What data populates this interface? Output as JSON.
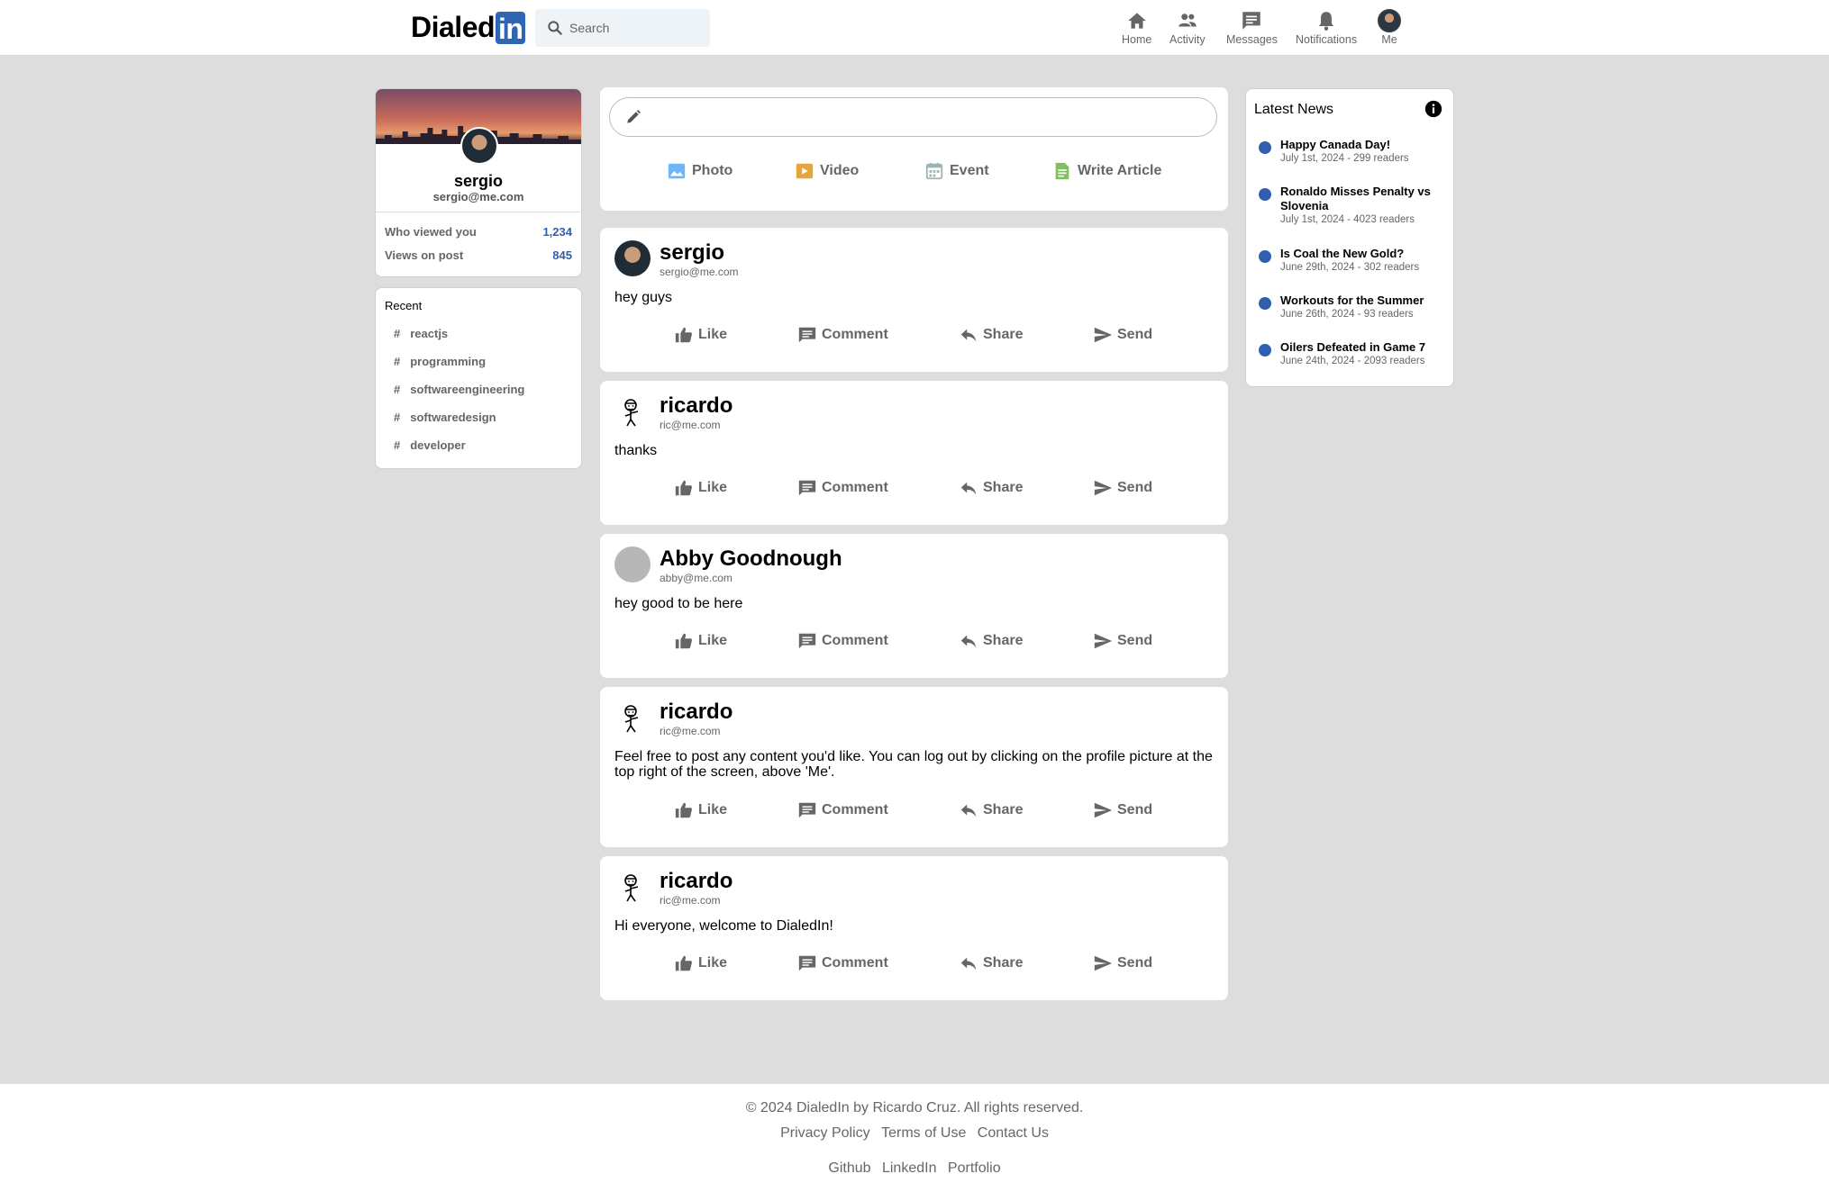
{
  "header": {
    "logo_text": "Dialed",
    "logo_badge": "in",
    "search_placeholder": "Search",
    "nav": [
      {
        "label": "Home",
        "icon": "home-icon"
      },
      {
        "label": "Activity",
        "icon": "people-icon"
      },
      {
        "label": "Messages",
        "icon": "message-icon"
      },
      {
        "label": "Notifications",
        "icon": "bell-icon"
      },
      {
        "label": "Me",
        "icon": "avatar"
      }
    ]
  },
  "profile": {
    "name": "sergio",
    "email": "sergio@me.com",
    "stats": [
      {
        "label": "Who viewed you",
        "value": "1,234"
      },
      {
        "label": "Views on post",
        "value": "845"
      }
    ]
  },
  "recent": {
    "title": "Recent",
    "tags": [
      "reactjs",
      "programming",
      "softwareengineering",
      "softwaredesign",
      "developer"
    ]
  },
  "composer": {
    "actions": [
      {
        "label": "Photo",
        "icon": "photo-icon",
        "color": "#70b5f9"
      },
      {
        "label": "Video",
        "icon": "video-icon",
        "color": "#e7a33e"
      },
      {
        "label": "Event",
        "icon": "calendar-icon",
        "color": "#a0b4b7"
      },
      {
        "label": "Write Article",
        "icon": "article-icon",
        "color": "#7fc15e"
      }
    ]
  },
  "post_actions": [
    "Like",
    "Comment",
    "Share",
    "Send"
  ],
  "posts": [
    {
      "author": "sergio",
      "email": "sergio@me.com",
      "body": "hey guys",
      "avatar": "photo"
    },
    {
      "author": "ricardo",
      "email": "ric@me.com",
      "body": "thanks",
      "avatar": "stick"
    },
    {
      "author": "Abby Goodnough",
      "email": "abby@me.com",
      "body": "hey good to be here",
      "avatar": "gray"
    },
    {
      "author": "ricardo",
      "email": "ric@me.com",
      "body": "Feel free to post any content you'd like. You can log out by clicking on the profile picture at the top right of the screen, above 'Me'.",
      "avatar": "stick"
    },
    {
      "author": "ricardo",
      "email": "ric@me.com",
      "body": "Hi everyone, welcome to DialedIn!",
      "avatar": "stick"
    }
  ],
  "news": {
    "title": "Latest News",
    "items": [
      {
        "headline": "Happy Canada Day!",
        "meta": "July 1st, 2024 - 299 readers"
      },
      {
        "headline": "Ronaldo Misses Penalty vs Slovenia",
        "meta": "July 1st, 2024 - 4023 readers"
      },
      {
        "headline": "Is Coal the New Gold?",
        "meta": "June 29th, 2024 - 302 readers"
      },
      {
        "headline": "Workouts for the Summer",
        "meta": "June 26th, 2024 - 93 readers"
      },
      {
        "headline": "Oilers Defeated in Game 7",
        "meta": "June 24th, 2024 - 2093 readers"
      }
    ]
  },
  "footer": {
    "copyright": "© 2024 DialedIn by Ricardo Cruz. All rights reserved.",
    "links": [
      "Privacy Policy",
      "Terms of Use",
      "Contact Us"
    ],
    "social": [
      "Github",
      "LinkedIn",
      "Portfolio"
    ]
  },
  "colors": {
    "accent": "#2f66b3",
    "stat_value": "#2f5fae",
    "background": "#dddddd"
  }
}
